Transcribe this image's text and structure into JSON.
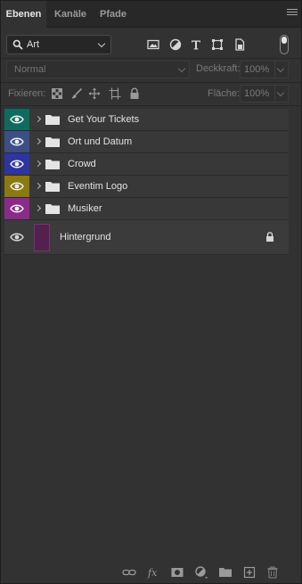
{
  "tabs": [
    {
      "label": "Ebenen",
      "active": true
    },
    {
      "label": "Kanäle",
      "active": false
    },
    {
      "label": "Pfade",
      "active": false
    }
  ],
  "filter": {
    "kind_label": "Art",
    "icons": [
      "pixel-filter-icon",
      "adjustment-filter-icon",
      "type-filter-icon",
      "shape-filter-icon",
      "smart-object-filter-icon"
    ]
  },
  "blend": {
    "mode_label": "Normal",
    "opacity_label": "Deckkraft:",
    "opacity_value": "100%"
  },
  "lock": {
    "label": "Fixieren:",
    "fill_label": "Fläche:",
    "fill_value": "100%"
  },
  "layers": [
    {
      "name": "Get Your Tickets",
      "type": "group",
      "color": "#0f6b5e"
    },
    {
      "name": "Ort und Datum",
      "type": "group",
      "color": "#3b4f86"
    },
    {
      "name": "Crowd",
      "type": "group",
      "color": "#2d34a3"
    },
    {
      "name": "Eventim Logo",
      "type": "group",
      "color": "#8a7a10"
    },
    {
      "name": "Musiker",
      "type": "group",
      "color": "#8a2a8a"
    },
    {
      "name": "Hintergrund",
      "type": "background",
      "color": "",
      "locked": true,
      "thumb_color": "#54204f"
    }
  ],
  "colors": {
    "panel_bg": "#323232",
    "tab_bar_bg": "#282828",
    "layer_row_bg": "#383838"
  }
}
